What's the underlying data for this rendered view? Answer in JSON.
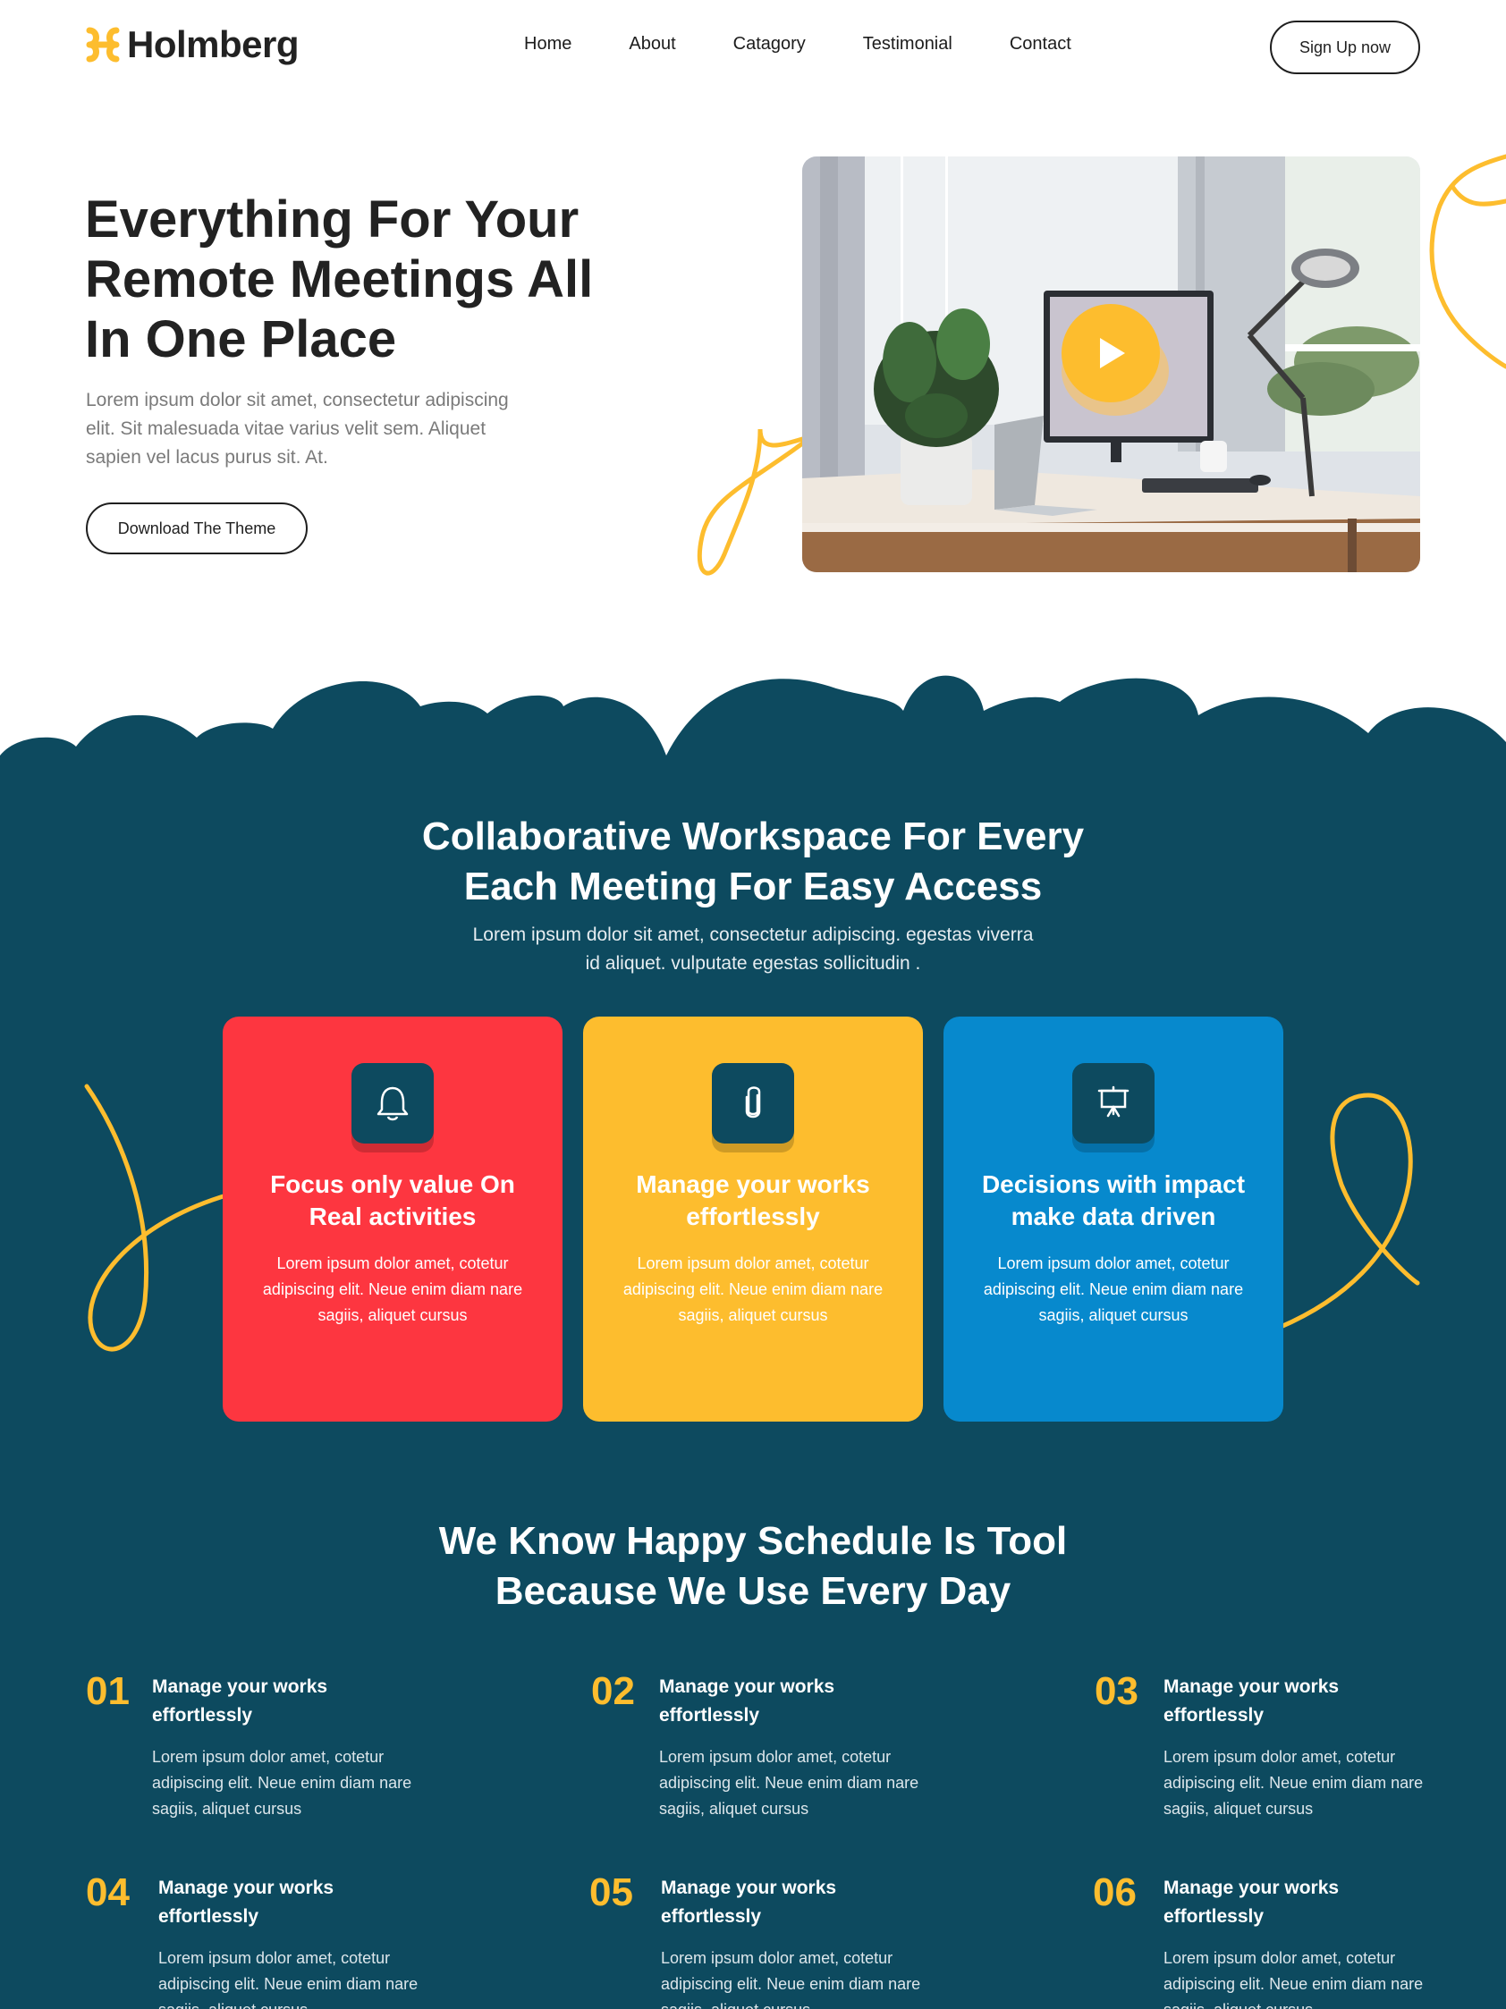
{
  "header": {
    "brand": "Holmberg",
    "nav": [
      "Home",
      "About",
      "Catagory",
      "Testimonial",
      "Contact"
    ],
    "signup_label": "Sign Up now"
  },
  "hero": {
    "title": "Everything For Your Remote Meetings All In One Place",
    "description": "Lorem ipsum dolor sit amet, consectetur adipiscing elit. Sit malesuada vitae varius velit sem. Aliquet sapien vel lacus purus sit. At.",
    "download_label": "Download The Theme"
  },
  "workspace": {
    "title": "Collaborative Workspace For Every Each Meeting For Easy Access",
    "description": "Lorem ipsum dolor sit amet, consectetur adipiscing. egestas viverra id aliquet. vulputate egestas sollicitudin .",
    "cards": [
      {
        "icon": "bell-icon",
        "title": "Focus only value On Real activities",
        "text": "Lorem ipsum dolor amet, cotetur adipiscing elit. Neue enim diam nare sagiis, aliquet cursus",
        "color": "#fd3640"
      },
      {
        "icon": "paperclip-icon",
        "title": "Manage your works effortlessly",
        "text": "Lorem ipsum dolor amet, cotetur adipiscing elit. Neue enim diam nare sagiis, aliquet cursus",
        "color": "#fdbd2e"
      },
      {
        "icon": "presentation-board-icon",
        "title": "Decisions with impact make data driven",
        "text": "Lorem ipsum dolor amet, cotetur adipiscing elit. Neue enim diam nare sagiis, aliquet cursus",
        "color": "#0789cd"
      }
    ]
  },
  "schedule": {
    "title": "We Know Happy Schedule Is Tool Because We Use Every Day",
    "features": [
      {
        "num": "01",
        "title": "Manage your works effortlessly",
        "text": "Lorem ipsum dolor amet, cotetur adipiscing elit. Neue enim diam nare sagiis, aliquet cursus"
      },
      {
        "num": "02",
        "title": "Manage your works effortlessly",
        "text": "Lorem ipsum dolor amet, cotetur adipiscing elit. Neue enim diam nare sagiis, aliquet cursus"
      },
      {
        "num": "03",
        "title": "Manage your works effortlessly",
        "text": "Lorem ipsum dolor amet, cotetur adipiscing elit. Neue enim diam nare sagiis, aliquet cursus"
      },
      {
        "num": "04",
        "title": "Manage your works effortlessly",
        "text": "Lorem ipsum dolor amet, cotetur adipiscing elit. Neue enim diam nare sagiis, aliquet cursus"
      },
      {
        "num": "05",
        "title": "Manage your works effortlessly",
        "text": "Lorem ipsum dolor amet, cotetur adipiscing elit. Neue enim diam nare sagiis, aliquet cursus"
      },
      {
        "num": "06",
        "title": "Manage your works effortlessly",
        "text": "Lorem ipsum dolor amet, cotetur adipiscing elit. Neue enim diam nare sagiis, aliquet cursus"
      }
    ]
  },
  "colors": {
    "accent_yellow": "#fdbd2e",
    "dark_teal": "#0d4a5f",
    "red": "#fd3640",
    "blue": "#0789cd"
  }
}
